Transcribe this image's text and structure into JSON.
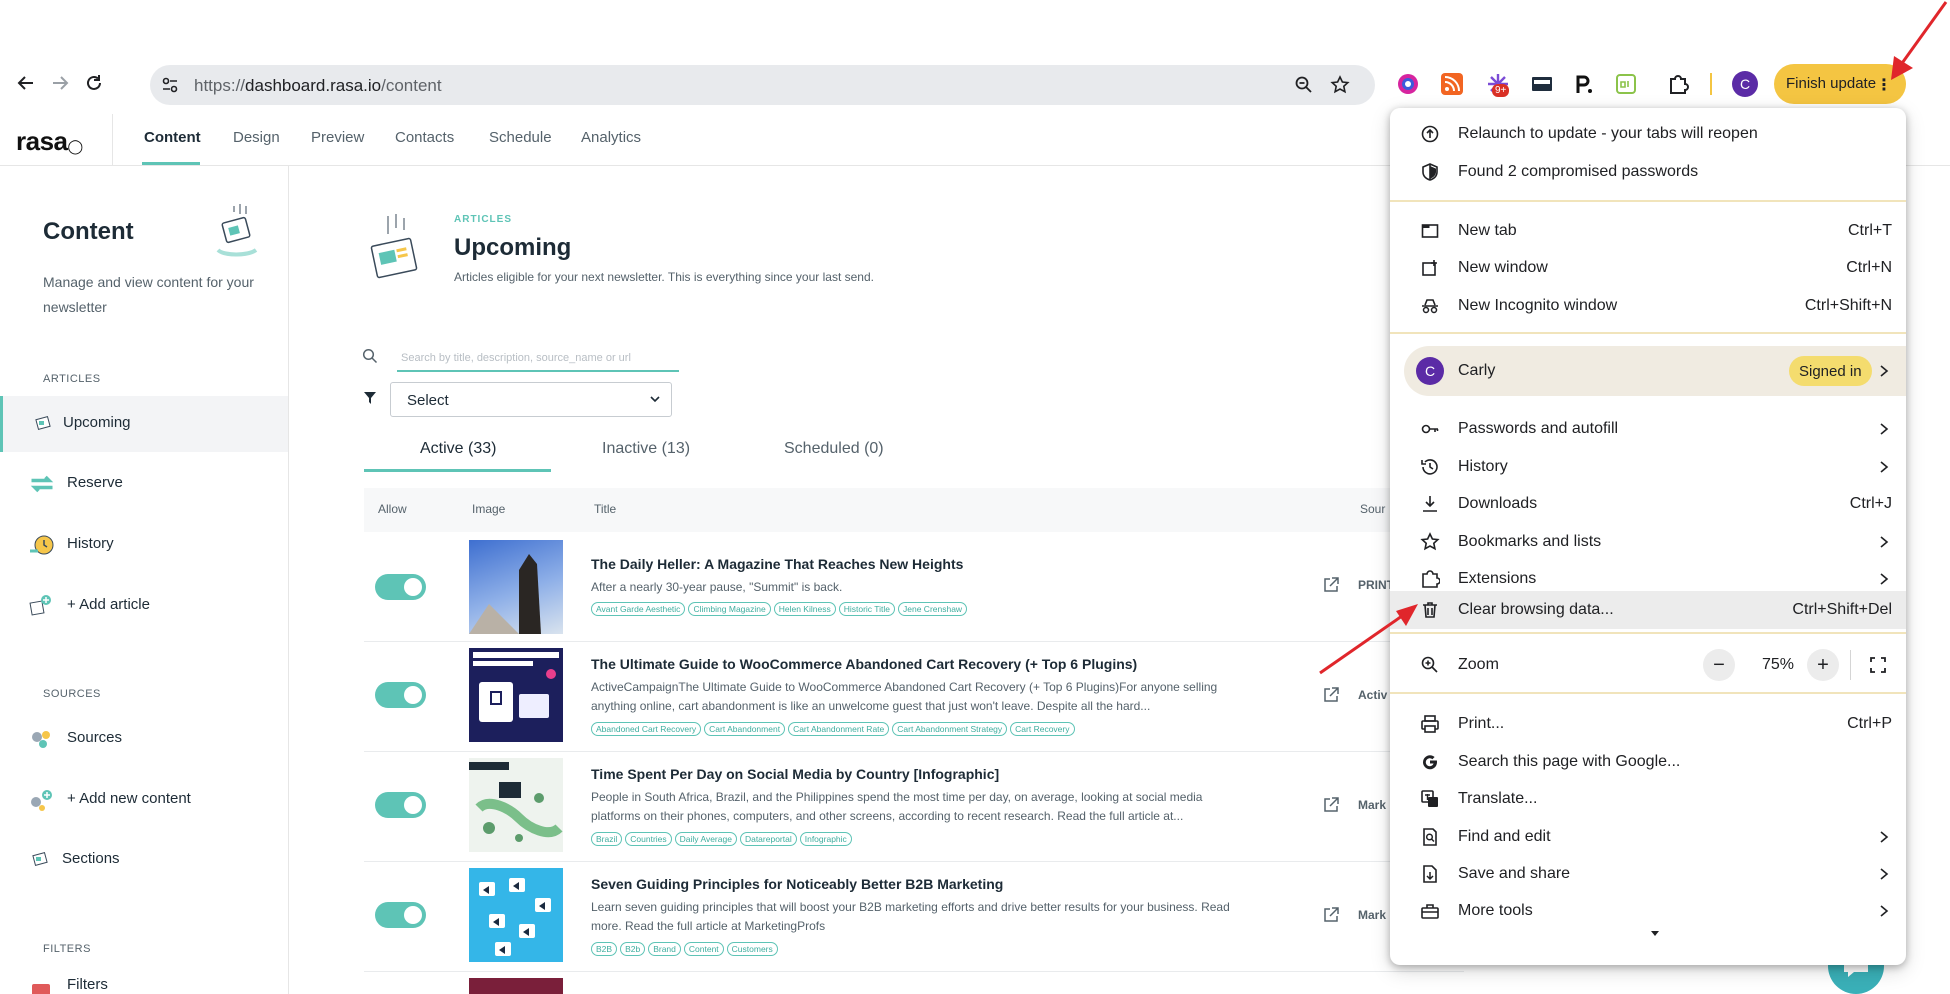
{
  "browser": {
    "url_prefix": "https://",
    "url_host": "dashboard.rasa.io",
    "url_path": "/content",
    "extension_badge": "9+",
    "profile_initial": "C",
    "finish_update_label": "Finish update",
    "menu_dots": "⋮"
  },
  "app": {
    "logo": "rasa",
    "tabs": [
      "Content",
      "Design",
      "Preview",
      "Contacts",
      "Schedule",
      "Analytics"
    ]
  },
  "sidebar": {
    "title": "Content",
    "description": "Manage and view content for your newsletter",
    "articles_heading": "ARTICLES",
    "articles_items": [
      "Upcoming",
      "Reserve",
      "History",
      "+ Add article"
    ],
    "sources_heading": "SOURCES",
    "sources_items": [
      "Sources",
      "+ Add new content",
      "Sections"
    ],
    "filters_heading": "FILTERS",
    "filters_item": "Filters"
  },
  "main": {
    "eyebrow": "ARTICLES",
    "title": "Upcoming",
    "description": "Articles eligible for your next newsletter. This is everything since your last send.",
    "search_placeholder": "Search by title, description, source_name or url",
    "select_value": "Select",
    "tabs": [
      "Active (33)",
      "Inactive (13)",
      "Scheduled (0)"
    ],
    "columns": [
      "Allow",
      "Image",
      "Title",
      "Sour"
    ],
    "rows": [
      {
        "title": "The Daily Heller: A Magazine That Reaches New Heights",
        "description": "After a nearly 30-year pause, \"Summit\" is back.",
        "tags": [
          "Avant Garde Aesthetic",
          "Climbing Magazine",
          "Helen Kilness",
          "Historic Title",
          "Jene Crenshaw"
        ],
        "source": "PRINT",
        "allowed": true
      },
      {
        "title": "The Ultimate Guide to WooCommerce Abandoned Cart Recovery (+ Top 6 Plugins)",
        "description": "ActiveCampaignThe Ultimate Guide to WooCommerce Abandoned Cart Recovery (+ Top 6 Plugins)For anyone selling anything online, cart abandonment is like an unwelcome guest that just won't leave. Despite all the hard...",
        "tags": [
          "Abandoned Cart Recovery",
          "Cart Abandonment",
          "Cart Abandonment Rate",
          "Cart Abandonment Strategy",
          "Cart Recovery"
        ],
        "source": "Activ",
        "allowed": true
      },
      {
        "title": "Time Spent Per Day on Social Media by Country [Infographic]",
        "description": "People in South Africa, Brazil, and the Philippines spend the most time per day, on average, looking at social media platforms on their phones, computers, and other screens, according to recent research. Read the full article at...",
        "tags": [
          "Brazil",
          "Countries",
          "Daily Average",
          "Datareportal",
          "Infographic"
        ],
        "source": "Mark",
        "allowed": true
      },
      {
        "title": "Seven Guiding Principles for Noticeably Better B2B Marketing",
        "description": "Learn seven guiding principles that will boost your B2B marketing efforts and drive better results for your business. Read more. Read the full article at MarketingProfs",
        "tags": [
          "B2B",
          "B2b",
          "Brand",
          "Content",
          "Customers"
        ],
        "source": "Mark",
        "allowed": true
      }
    ]
  },
  "menu": {
    "top_items": [
      {
        "label": "Relaunch to update - your tabs will reopen",
        "icon": "update-icon"
      },
      {
        "label": "Found 2 compromised passwords",
        "icon": "shield-icon"
      }
    ],
    "window_items": [
      {
        "label": "New tab",
        "shortcut": "Ctrl+T",
        "icon": "new-tab-icon"
      },
      {
        "label": "New window",
        "shortcut": "Ctrl+N",
        "icon": "new-window-icon"
      },
      {
        "label": "New Incognito window",
        "shortcut": "Ctrl+Shift+N",
        "icon": "incognito-icon"
      }
    ],
    "profile": {
      "initial": "C",
      "name": "Carly",
      "status": "Signed in"
    },
    "profile_items": [
      {
        "label": "Passwords and autofill",
        "icon": "key-icon",
        "submenu": true
      },
      {
        "label": "History",
        "icon": "history-icon",
        "submenu": true
      },
      {
        "label": "Downloads",
        "shortcut": "Ctrl+J",
        "icon": "download-icon"
      },
      {
        "label": "Bookmarks and lists",
        "icon": "star-icon",
        "submenu": true
      },
      {
        "label": "Extensions",
        "icon": "puzzle-icon",
        "submenu": true
      },
      {
        "label": "Clear browsing data...",
        "shortcut": "Ctrl+Shift+Del",
        "icon": "trash-icon"
      }
    ],
    "zoom": {
      "label": "Zoom",
      "value": "75%",
      "minus": "−",
      "plus": "+"
    },
    "tool_items": [
      {
        "label": "Print...",
        "shortcut": "Ctrl+P",
        "icon": "print-icon"
      },
      {
        "label": "Search this page with Google...",
        "icon": "google-icon"
      },
      {
        "label": "Translate...",
        "icon": "translate-icon"
      },
      {
        "label": "Find and edit",
        "icon": "find-icon",
        "submenu": true
      },
      {
        "label": "Save and share",
        "icon": "save-share-icon",
        "submenu": true
      },
      {
        "label": "More tools",
        "icon": "toolbox-icon",
        "submenu": true
      }
    ]
  },
  "colors": {
    "accent": "#5ec4b6",
    "update_button": "#f4c542",
    "profile": "#5b2ba6",
    "annotation_arrow": "#e0262b"
  }
}
